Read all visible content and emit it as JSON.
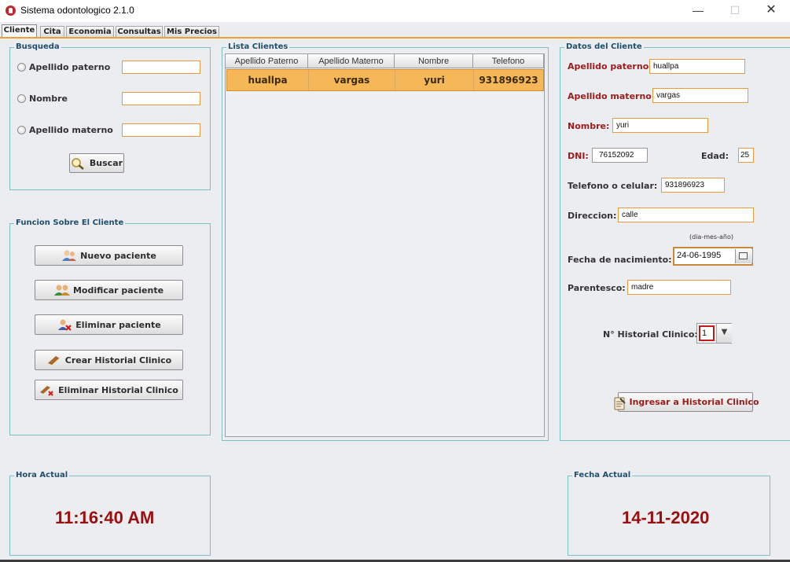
{
  "window": {
    "title": "Sistema odontologico 2.1.0",
    "minimize": "—",
    "maximize": "☐",
    "close": "✕"
  },
  "tabs": [
    "Cliente",
    "Cita",
    "Economia",
    "Consultas",
    "Mis Precios"
  ],
  "busqueda": {
    "title": "Busqueda",
    "options": [
      "Apellido paterno",
      "Nombre",
      "Apellido materno"
    ],
    "values": [
      "",
      "",
      ""
    ],
    "search_button": "Buscar"
  },
  "funciones": {
    "title": "Funcion Sobre El Cliente",
    "buttons": [
      "Nuevo paciente",
      "Modificar paciente",
      "Eliminar paciente",
      "Crear Historial Clinico",
      "Eliminar Historial Clinico"
    ]
  },
  "lista": {
    "title": "Lista Clientes",
    "columns": [
      "Apellido Paterno",
      "Apellido Materno",
      "Nombre",
      "Telefono"
    ],
    "rows": [
      [
        "huallpa",
        "vargas",
        "yuri",
        "931896923"
      ]
    ]
  },
  "datos": {
    "title": "Datos del Cliente",
    "apellido_paterno_label": "Apellido paterno:",
    "apellido_paterno": "huallpa",
    "apellido_materno_label": "Apellido materno:",
    "apellido_materno": "vargas",
    "nombre_label": "Nombre:",
    "nombre": "yuri",
    "dni_label": "DNI:",
    "dni": "76152092",
    "edad_label": "Edad:",
    "edad": "25",
    "telefono_label": "Telefono o celular:",
    "telefono": "931896923",
    "direccion_label": "Direccion:",
    "direccion": "calle",
    "fecha_hint": "(dia-mes-año)",
    "fecha_label": "Fecha de nacimiento:",
    "fecha": "24-06-1995",
    "parentesco_label": "Parentesco:",
    "parentesco": "madre",
    "historial_label": "N° Historial Clinico:",
    "historial": "1",
    "ingresar_button": "Ingresar a Historial Clinico"
  },
  "hora": {
    "title": "Hora Actual",
    "value": "11:16:40 AM"
  },
  "fecha_actual": {
    "title": "Fecha Actual",
    "value": "14-11-2020"
  },
  "colors": {
    "accent": "#f6b758",
    "clock": "#9b0e0e",
    "label_red": "#9b1c1c",
    "border": "#7cc1c6"
  }
}
